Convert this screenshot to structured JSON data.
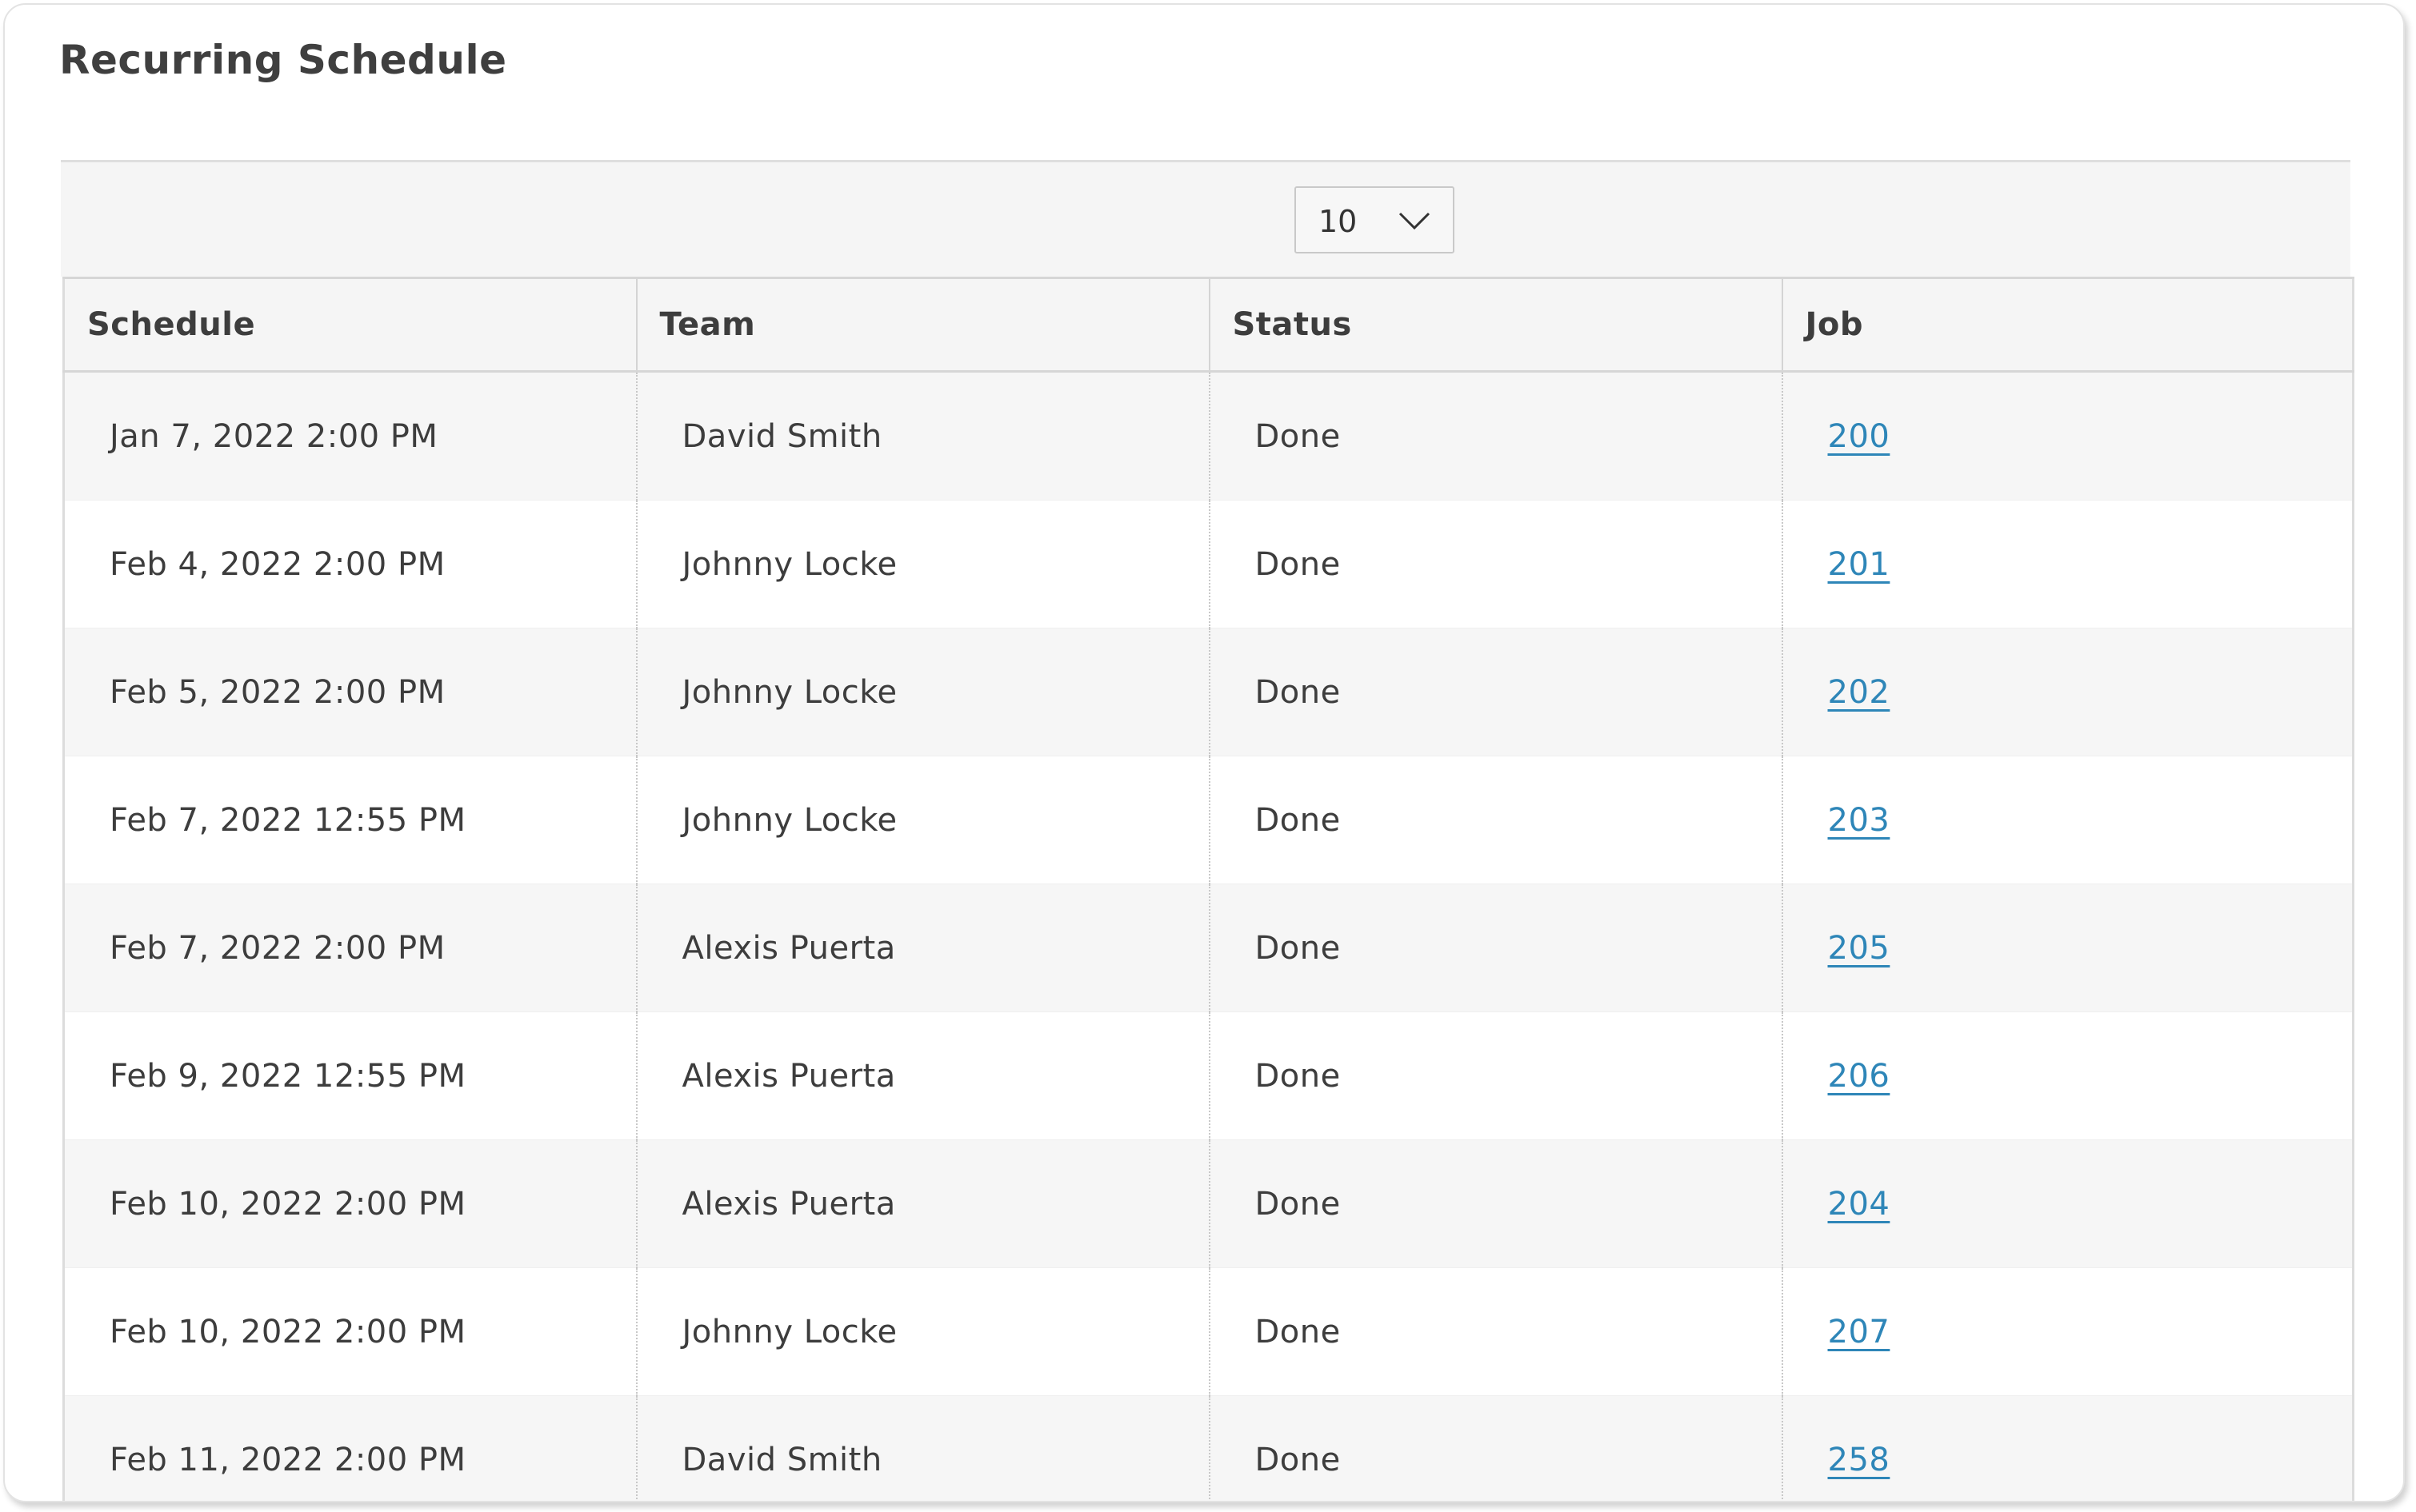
{
  "panel": {
    "title": "Recurring Schedule"
  },
  "toolbar": {
    "page_size_value": "10"
  },
  "table": {
    "columns": [
      "Schedule",
      "Team",
      "Status",
      "Job"
    ],
    "rows": [
      {
        "schedule": "Jan 7, 2022 2:00 PM",
        "team": "David Smith",
        "status": "Done",
        "job": "200"
      },
      {
        "schedule": "Feb 4, 2022 2:00 PM",
        "team": "Johnny Locke",
        "status": "Done",
        "job": "201"
      },
      {
        "schedule": "Feb 5, 2022 2:00 PM",
        "team": "Johnny Locke",
        "status": "Done",
        "job": "202"
      },
      {
        "schedule": "Feb 7, 2022 12:55 PM",
        "team": "Johnny Locke",
        "status": "Done",
        "job": "203"
      },
      {
        "schedule": "Feb 7, 2022 2:00 PM",
        "team": "Alexis Puerta",
        "status": "Done",
        "job": "205"
      },
      {
        "schedule": "Feb 9, 2022 12:55 PM",
        "team": "Alexis Puerta",
        "status": "Done",
        "job": "206"
      },
      {
        "schedule": "Feb 10, 2022 2:00 PM",
        "team": "Alexis Puerta",
        "status": "Done",
        "job": "204"
      },
      {
        "schedule": "Feb 10, 2022 2:00 PM",
        "team": "Johnny Locke",
        "status": "Done",
        "job": "207"
      },
      {
        "schedule": "Feb 11, 2022 2:00 PM",
        "team": "David Smith",
        "status": "Done",
        "job": "258"
      }
    ]
  },
  "icons": {
    "page_size_dropdown": "chevron-down-icon"
  },
  "colors": {
    "link": "#2e86b8",
    "header_bg": "#f5f5f5",
    "row_alt_bg": "#f6f6f6",
    "text": "#3d3d3d"
  }
}
